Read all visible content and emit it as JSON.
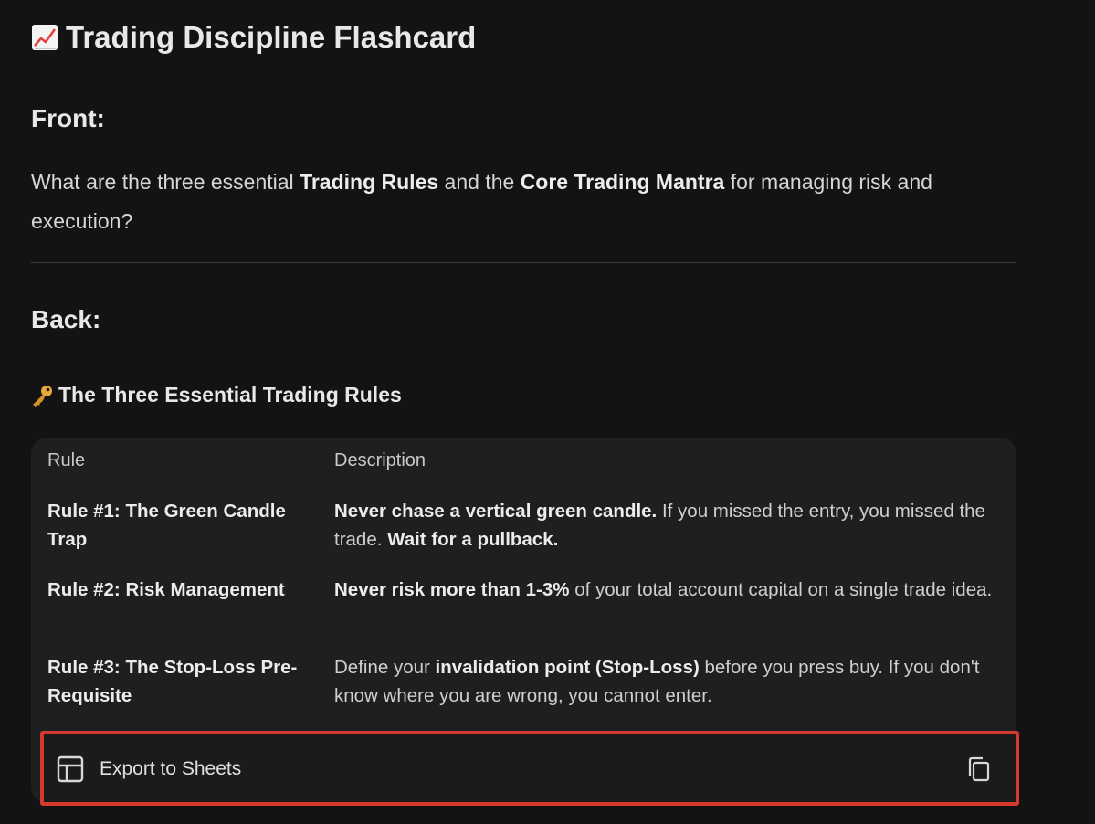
{
  "title": "Trading Discipline Flashcard",
  "front": {
    "heading": "Front:",
    "question_parts": {
      "p1": "What are the three essential ",
      "b1": "Trading Rules",
      "p2": " and the ",
      "b2": "Core Trading Mantra",
      "p3": " for managing risk and execution?"
    }
  },
  "back": {
    "heading": "Back:",
    "section_title": "The Three Essential Trading Rules",
    "table": {
      "headers": [
        "Rule",
        "Description"
      ],
      "rows": [
        {
          "rule": "Rule #1: The Green Candle Trap",
          "bold1": "Never chase a vertical green candle.",
          "text1": " If you missed the entry, you missed the trade. ",
          "bold2": "Wait for a pullback.",
          "text2": ""
        },
        {
          "rule": "Rule #2: Risk Management",
          "bold1": "Never risk more than 1-3%",
          "text1": " of your total account capital on a single trade idea.",
          "bold2": "",
          "text2": ""
        },
        {
          "rule": "Rule #3: The Stop-Loss Pre-Requisite",
          "text0": "Define your ",
          "bold1": "invalidation point (Stop-Loss)",
          "text1": " before you press buy. If you don't know where you are wrong, you cannot enter.",
          "bold2": "",
          "text2": ""
        }
      ]
    }
  },
  "export": {
    "label": "Export to Sheets"
  },
  "icons": {
    "title_emoji": "chart-increasing-icon",
    "section_emoji": "key-icon",
    "sheets": "table-icon",
    "copy": "copy-icon"
  },
  "colors": {
    "background": "#131314",
    "card": "#1e1f20",
    "highlight_border": "#d63a2f"
  }
}
